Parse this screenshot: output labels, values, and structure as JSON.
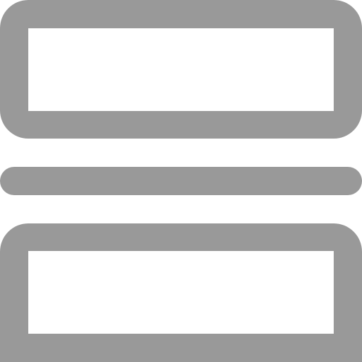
{
  "icon": {
    "name": "split-horizontal-icon",
    "stroke_color": "#999999",
    "background_color": "#ffffff"
  }
}
